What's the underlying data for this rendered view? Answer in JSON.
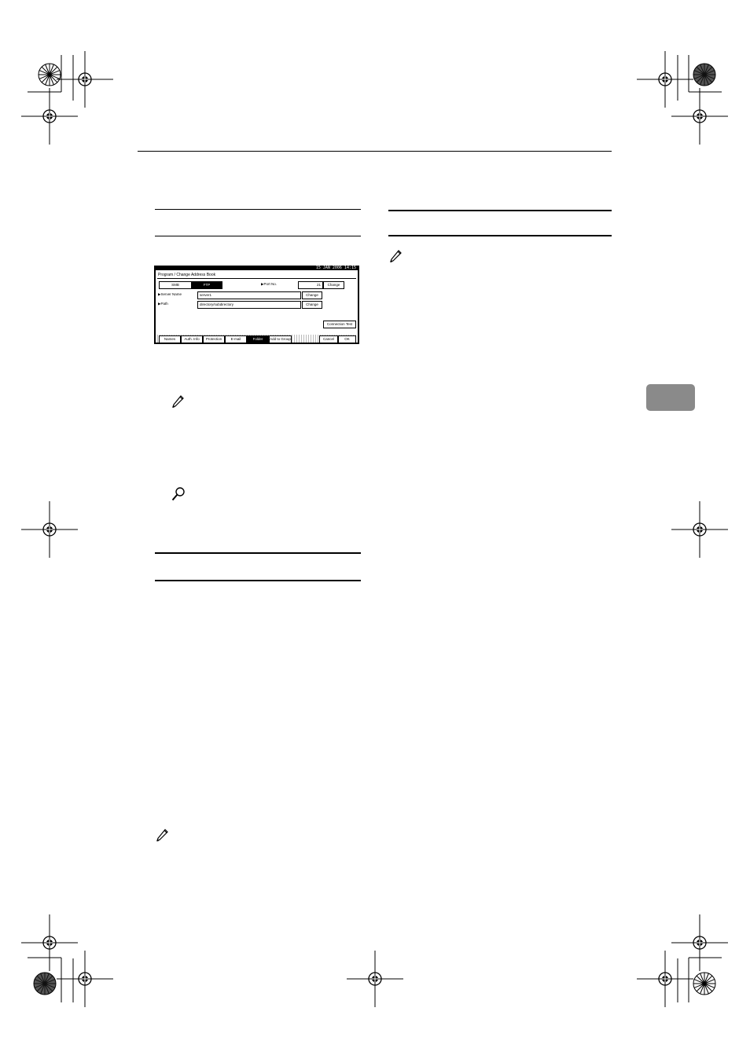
{
  "colors": {
    "text": "#000000",
    "tab": "#8a8a8a",
    "screen_bg": "#000000"
  },
  "icons": {
    "note_1": "pencil-note-icon",
    "reference_1": "magnifier-reference-icon",
    "note_2": "pencil-note-icon",
    "note_3": "pencil-note-icon",
    "registration_marks": "crosshair-registration-mark-icon",
    "color_targets": "sunburst-color-target-icon"
  },
  "screen": {
    "clock": "15 JAN 2006 14:15",
    "title": "Program / Change Address Book",
    "protocol_smb": "SMB",
    "protocol_ftp": "FTP",
    "port_label": "▶Port No.",
    "port_value": "21",
    "port_change": "Change",
    "server_label": "▶Server Name",
    "server_value": "server1",
    "server_change": "Change",
    "path_label": "▶Path",
    "path_value": "directory/subdirectory",
    "path_change": "Change",
    "connection_test": "Connection Test",
    "tabs": [
      "Names",
      "Auth. Info",
      "Protection",
      "E-mail",
      "Folder",
      "Add to Group"
    ],
    "cancel": "Cancel",
    "ok": "OK"
  }
}
